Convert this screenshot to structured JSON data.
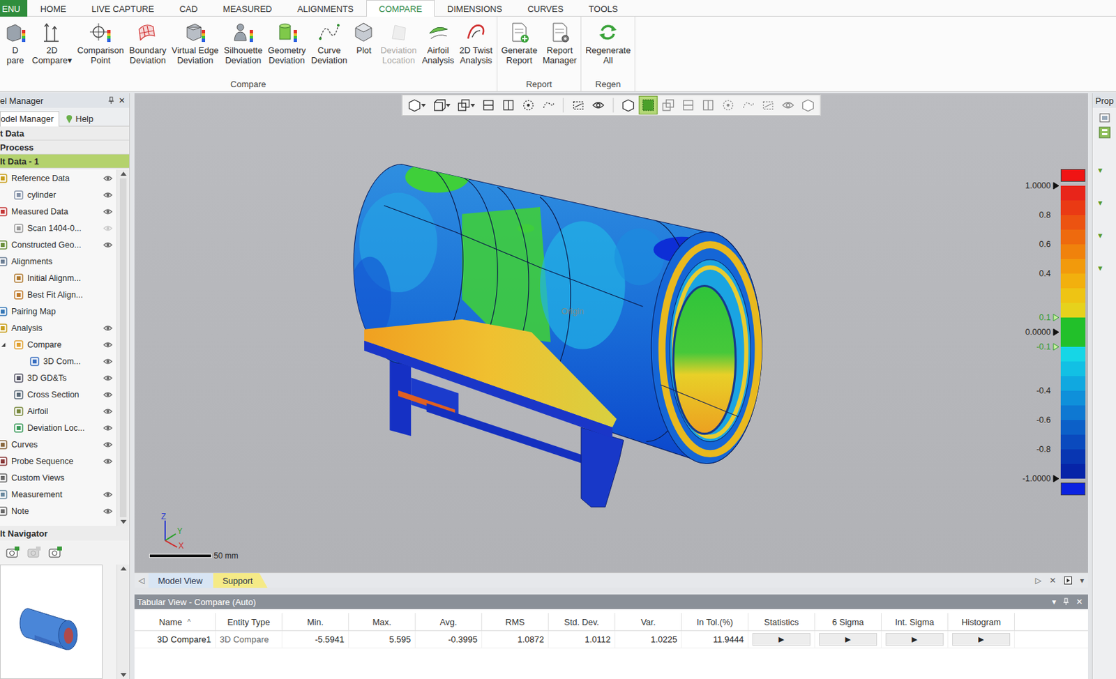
{
  "ribbon_tabs": [
    {
      "label": "ENU",
      "selected": false,
      "kind": "file"
    },
    {
      "label": "HOME",
      "selected": false,
      "kind": "tab"
    },
    {
      "label": "LIVE CAPTURE",
      "selected": false,
      "kind": "tab"
    },
    {
      "label": "CAD",
      "selected": false,
      "kind": "tab"
    },
    {
      "label": "MEASURED",
      "selected": false,
      "kind": "tab"
    },
    {
      "label": "ALIGNMENTS",
      "selected": false,
      "kind": "tab"
    },
    {
      "label": "COMPARE",
      "selected": true,
      "kind": "tab"
    },
    {
      "label": "DIMENSIONS",
      "selected": false,
      "kind": "tab"
    },
    {
      "label": "CURVES",
      "selected": false,
      "kind": "tab"
    },
    {
      "label": "TOOLS",
      "selected": false,
      "kind": "tab"
    }
  ],
  "ribbon_groups": [
    {
      "label": "Compare",
      "buttons": [
        {
          "lines": [
            "D",
            "pare"
          ],
          "disabled": false
        },
        {
          "lines": [
            "2D",
            "Compare"
          ],
          "caret": "▾",
          "disabled": false
        },
        {
          "lines": [
            "Comparison",
            "Point"
          ],
          "disabled": false
        },
        {
          "lines": [
            "Boundary",
            "Deviation"
          ],
          "disabled": false
        },
        {
          "lines": [
            "Virtual Edge",
            "Deviation"
          ],
          "disabled": false
        },
        {
          "lines": [
            "Silhouette",
            "Deviation"
          ],
          "disabled": false
        },
        {
          "lines": [
            "Geometry",
            "Deviation"
          ],
          "disabled": false
        },
        {
          "lines": [
            "Curve",
            "Deviation"
          ],
          "disabled": false
        },
        {
          "lines": [
            "Plot"
          ],
          "disabled": false
        },
        {
          "lines": [
            "Deviation",
            "Location"
          ],
          "disabled": true
        },
        {
          "lines": [
            "Airfoil",
            "Analysis"
          ],
          "disabled": false
        },
        {
          "lines": [
            "2D Twist",
            "Analysis"
          ],
          "disabled": false
        }
      ]
    },
    {
      "label": "Report",
      "buttons": [
        {
          "lines": [
            "Generate",
            "Report"
          ],
          "disabled": false
        },
        {
          "lines": [
            "Report",
            "Manager"
          ],
          "disabled": false
        }
      ]
    },
    {
      "label": "Regen",
      "buttons": [
        {
          "lines": [
            "Regenerate",
            "All"
          ],
          "disabled": false
        }
      ]
    }
  ],
  "model_manager": {
    "title": "el Manager",
    "close": "✕",
    "tabs": [
      {
        "label": "odel Manager",
        "selected": true
      },
      {
        "label": "Help",
        "selected": false
      }
    ],
    "sections": [
      {
        "label": "t Data",
        "selected": false
      },
      {
        "label": "Process",
        "selected": false
      },
      {
        "label": "lt Data - 1",
        "selected": true
      }
    ],
    "tree": [
      {
        "label": "Reference Data",
        "level": 0,
        "eye": "visible",
        "expanded": false
      },
      {
        "label": "cylinder",
        "level": 1,
        "eye": "visible",
        "expanded": false
      },
      {
        "label": "Measured Data",
        "level": 0,
        "eye": "visible",
        "expanded": false
      },
      {
        "label": "Scan 1404-0...",
        "level": 1,
        "eye": "hidden",
        "expanded": false
      },
      {
        "label": "Constructed Geo...",
        "level": 0,
        "eye": "visible",
        "expanded": false
      },
      {
        "label": "Alignments",
        "level": 0,
        "eye": "none",
        "expanded": false
      },
      {
        "label": "Initial Alignm...",
        "level": 1,
        "eye": "none",
        "expanded": false
      },
      {
        "label": "Best Fit Align...",
        "level": 1,
        "eye": "none",
        "expanded": false
      },
      {
        "label": "Pairing Map",
        "level": 0,
        "eye": "none",
        "expanded": false
      },
      {
        "label": "Analysis",
        "level": 0,
        "eye": "visible",
        "expanded": false
      },
      {
        "label": "Compare",
        "level": 1,
        "eye": "visible",
        "expanded": true
      },
      {
        "label": "3D Com...",
        "level": 2,
        "eye": "visible",
        "expanded": false
      },
      {
        "label": "3D GD&Ts",
        "level": 1,
        "eye": "visible",
        "expanded": false
      },
      {
        "label": "Cross Section",
        "level": 1,
        "eye": "visible",
        "expanded": false
      },
      {
        "label": "Airfoil",
        "level": 1,
        "eye": "visible",
        "expanded": false
      },
      {
        "label": "Deviation Loc...",
        "level": 1,
        "eye": "visible",
        "expanded": false
      },
      {
        "label": "Curves",
        "level": 0,
        "eye": "visible",
        "expanded": false
      },
      {
        "label": "Probe Sequence",
        "level": 0,
        "eye": "visible",
        "expanded": false
      },
      {
        "label": "Custom Views",
        "level": 0,
        "eye": "none",
        "expanded": false
      },
      {
        "label": "Measurement",
        "level": 0,
        "eye": "visible",
        "expanded": false
      },
      {
        "label": "Note",
        "level": 0,
        "eye": "visible",
        "expanded": false
      }
    ],
    "navigator": {
      "title": "lt Navigator"
    }
  },
  "viewport": {
    "origin_label": "Origin",
    "axes": [
      "Z",
      "Y",
      "X"
    ],
    "scale_bar": "50 mm",
    "tools": [
      {
        "group": 1,
        "caret": true,
        "selected": false
      },
      {
        "group": 1,
        "caret": true,
        "selected": false
      },
      {
        "group": 1,
        "caret": true,
        "selected": false
      },
      {
        "group": 1,
        "caret": false,
        "selected": false
      },
      {
        "group": 1,
        "caret": false,
        "selected": false
      },
      {
        "group": 1,
        "caret": false,
        "selected": false
      },
      {
        "group": 1,
        "caret": false,
        "selected": false
      },
      {
        "group": 2,
        "caret": false,
        "selected": false
      },
      {
        "group": 2,
        "caret": false,
        "selected": false
      },
      {
        "group": 3,
        "caret": false,
        "selected": false
      },
      {
        "group": 3,
        "caret": false,
        "selected": true
      },
      {
        "group": 3,
        "caret": false,
        "selected": false
      },
      {
        "group": 3,
        "caret": false,
        "selected": false
      },
      {
        "group": 3,
        "caret": false,
        "selected": false
      },
      {
        "group": 3,
        "caret": false,
        "selected": false
      },
      {
        "group": 3,
        "caret": false,
        "selected": false
      },
      {
        "group": 3,
        "caret": false,
        "selected": false
      },
      {
        "group": 3,
        "caret": false,
        "selected": false
      },
      {
        "group": 3,
        "caret": false,
        "selected": false
      }
    ],
    "legend": {
      "over_color": "#f01414",
      "under_color": "#0a22e0",
      "bands": [
        "#e8251a",
        "#ea3a14",
        "#ec5311",
        "#ee6a0e",
        "#f0820c",
        "#f29a0c",
        "#f2b00e",
        "#eec414",
        "#e6d21c",
        "#22c02a",
        "#22c02a",
        "#16d6e6",
        "#12c0e4",
        "#10a8e0",
        "#0f90da",
        "#0e78d2",
        "#0c60c8",
        "#0a4abe",
        "#0836b2",
        "#0624a8"
      ],
      "ticks": [
        {
          "label": "1.0000",
          "value": 1.0,
          "marker": "black",
          "tolerance": false
        },
        {
          "label": "0.8",
          "value": 0.8,
          "marker": "none",
          "tolerance": false
        },
        {
          "label": "0.6",
          "value": 0.6,
          "marker": "none",
          "tolerance": false
        },
        {
          "label": "0.4",
          "value": 0.4,
          "marker": "none",
          "tolerance": false
        },
        {
          "label": "0.1",
          "value": 0.1,
          "marker": "green",
          "tolerance": true
        },
        {
          "label": "0.0000",
          "value": 0.0,
          "marker": "black",
          "tolerance": false
        },
        {
          "label": "-0.1",
          "value": -0.1,
          "marker": "green",
          "tolerance": true
        },
        {
          "label": "-0.4",
          "value": -0.4,
          "marker": "none",
          "tolerance": false
        },
        {
          "label": "-0.6",
          "value": -0.6,
          "marker": "none",
          "tolerance": false
        },
        {
          "label": "-0.8",
          "value": -0.8,
          "marker": "none",
          "tolerance": false
        },
        {
          "label": "-1.0000",
          "value": -1.0,
          "marker": "black",
          "tolerance": false
        }
      ]
    }
  },
  "doc_tabs": {
    "left": "◁",
    "tabs": [
      {
        "label": "Model View",
        "selected": true,
        "color": "#d8e5f4"
      },
      {
        "label": "Support",
        "selected": false,
        "color": "#f5ea86"
      }
    ],
    "right": [
      "▷",
      "✕"
    ],
    "menu": "▾"
  },
  "tabular": {
    "title": "Tabular View - Compare (Auto)",
    "menu": "▾",
    "close": "✕",
    "columns": [
      {
        "label": "Name",
        "kind": "name",
        "sort": "^"
      },
      {
        "label": "Entity Type",
        "kind": "type"
      },
      {
        "label": "Min.",
        "kind": "number"
      },
      {
        "label": "Max.",
        "kind": "number"
      },
      {
        "label": "Avg.",
        "kind": "number"
      },
      {
        "label": "RMS",
        "kind": "number"
      },
      {
        "label": "Std. Dev.",
        "kind": "number"
      },
      {
        "label": "Var.",
        "kind": "number"
      },
      {
        "label": "In Tol.(%)",
        "kind": "number"
      },
      {
        "label": "Statistics",
        "kind": "button"
      },
      {
        "label": "6 Sigma",
        "kind": "button"
      },
      {
        "label": "Int. Sigma",
        "kind": "button"
      },
      {
        "label": "Histogram",
        "kind": "button"
      }
    ],
    "rows": [
      {
        "selected": false,
        "cells": [
          "3D Compare1",
          "3D Compare",
          "-5.5941",
          "5.595",
          "-0.3995",
          "1.0872",
          "1.0112",
          "1.0225",
          "11.9444",
          "▶",
          "▶",
          "▶",
          "▶"
        ]
      }
    ]
  },
  "properties": {
    "title": "Prop",
    "markers": [
      "▾",
      "▾",
      "▾",
      "▾"
    ]
  }
}
